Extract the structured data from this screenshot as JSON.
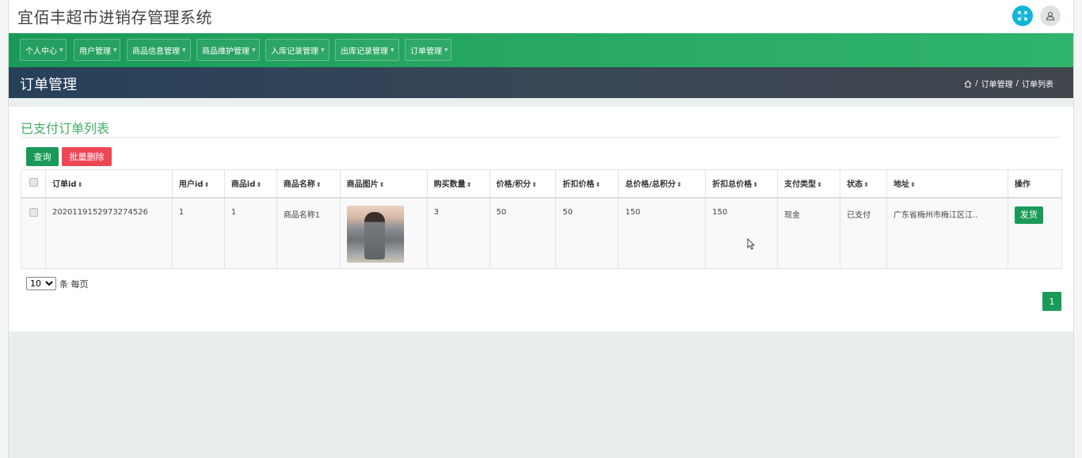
{
  "app": {
    "title": "宜佰丰超市进销存管理系统"
  },
  "nav": {
    "items": [
      {
        "label": "个人中心"
      },
      {
        "label": "用户管理"
      },
      {
        "label": "商品信息管理"
      },
      {
        "label": "商品维护管理"
      },
      {
        "label": "入库记录管理"
      },
      {
        "label": "出库记录管理"
      },
      {
        "label": "订单管理"
      }
    ]
  },
  "page": {
    "title": "订单管理",
    "breadcrumb": {
      "separator": "/",
      "section": "订单管理",
      "current": "订单列表"
    }
  },
  "card": {
    "title": "已支付订单列表",
    "query_button": "查询",
    "batch_delete_button": "批量删除"
  },
  "table": {
    "headers": [
      "订单id",
      "用户id",
      "商品id",
      "商品名称",
      "商品图片",
      "购买数量",
      "价格/积分",
      "折扣价格",
      "总价格/总积分",
      "折扣总价格",
      "支付类型",
      "状态",
      "地址",
      "操作"
    ],
    "rows": [
      {
        "order_id": "2020119152973274526",
        "user_id": "1",
        "product_id": "1",
        "product_name": "商品名称1",
        "quantity": "3",
        "price": "50",
        "discount_price": "50",
        "total_price": "150",
        "discount_total": "150",
        "pay_type": "现金",
        "status": "已支付",
        "address": "广东省梅州市梅江区江..",
        "action": "发货"
      }
    ]
  },
  "pagination": {
    "page_size": "10",
    "page_size_suffix": "条 每页",
    "current_page": "1"
  },
  "colors": {
    "primary_green": "#1a9a58",
    "danger_red": "#ef4655",
    "title_green": "#3fae63",
    "accent_cyan": "#12b5d8"
  },
  "icons": {
    "fullscreen": "fullscreen-icon",
    "user": "user-icon",
    "home": "home-icon",
    "sort": "sort-icon",
    "cursor": "mouse-cursor-icon"
  }
}
